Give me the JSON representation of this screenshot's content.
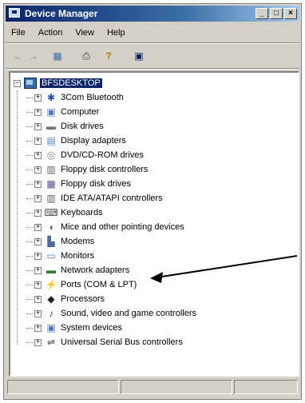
{
  "window": {
    "title": "Device Manager",
    "controls": {
      "minimize": "_",
      "maximize": "□",
      "close": "×"
    }
  },
  "menu": [
    "File",
    "Action",
    "View",
    "Help"
  ],
  "toolbar": [
    {
      "icon": "back-arrow-icon",
      "glyph": "←"
    },
    {
      "icon": "forward-arrow-icon",
      "glyph": "→"
    },
    {
      "icon": "properties-icon",
      "glyph": "▦"
    },
    {
      "icon": "print-icon",
      "glyph": "⎙"
    },
    {
      "icon": "help-icon",
      "glyph": "?"
    },
    {
      "icon": "scan-hardware-icon",
      "glyph": "▣"
    }
  ],
  "tree": {
    "root": {
      "label": "BFSDESKTOP",
      "expander": "−"
    },
    "items": [
      {
        "label": "3Com Bluetooth",
        "icon": "bluetooth-icon",
        "glyph": "✱",
        "color": "#1e4fbf"
      },
      {
        "label": "Computer",
        "icon": "computer-icon",
        "glyph": "▣",
        "color": "#4a7ac0"
      },
      {
        "label": "Disk drives",
        "icon": "disk-drive-icon",
        "glyph": "▬",
        "color": "#707070"
      },
      {
        "label": "Display adapters",
        "icon": "display-adapter-icon",
        "glyph": "▤",
        "color": "#4a7ac0"
      },
      {
        "label": "DVD/CD-ROM drives",
        "icon": "cdrom-icon",
        "glyph": "◎",
        "color": "#808080"
      },
      {
        "label": "Floppy disk controllers",
        "icon": "floppy-controller-icon",
        "glyph": "▥",
        "color": "#606060"
      },
      {
        "label": "Floppy disk drives",
        "icon": "floppy-drive-icon",
        "glyph": "▦",
        "color": "#505090"
      },
      {
        "label": "IDE ATA/ATAPI controllers",
        "icon": "ide-controller-icon",
        "glyph": "▥",
        "color": "#606060"
      },
      {
        "label": "Keyboards",
        "icon": "keyboard-icon",
        "glyph": "⌨",
        "color": "#505050"
      },
      {
        "label": "Mice and other pointing devices",
        "icon": "mouse-icon",
        "glyph": "◖",
        "color": "#606060"
      },
      {
        "label": "Modems",
        "icon": "modem-icon",
        "glyph": "▙",
        "color": "#4a6aa0"
      },
      {
        "label": "Monitors",
        "icon": "monitor-icon",
        "glyph": "▭",
        "color": "#4a7ac0"
      },
      {
        "label": "Network adapters",
        "icon": "network-adapter-icon",
        "glyph": "▬",
        "color": "#2e7a2e"
      },
      {
        "label": "Ports (COM & LPT)",
        "icon": "port-icon",
        "glyph": "⚡",
        "color": "#606060"
      },
      {
        "label": "Processors",
        "icon": "processor-icon",
        "glyph": "◆",
        "color": "#202020"
      },
      {
        "label": "Sound, video and game controllers",
        "icon": "sound-icon",
        "glyph": "♪",
        "color": "#404040"
      },
      {
        "label": "System devices",
        "icon": "system-devices-icon",
        "glyph": "▣",
        "color": "#4a7ac0"
      },
      {
        "label": "Universal Serial Bus controllers",
        "icon": "usb-icon",
        "glyph": "⇌",
        "color": "#404040"
      }
    ],
    "collapsed_expander": "+"
  },
  "annotation": {
    "points_to": "Ports (COM & LPT)",
    "arrow_color": "#000000"
  }
}
